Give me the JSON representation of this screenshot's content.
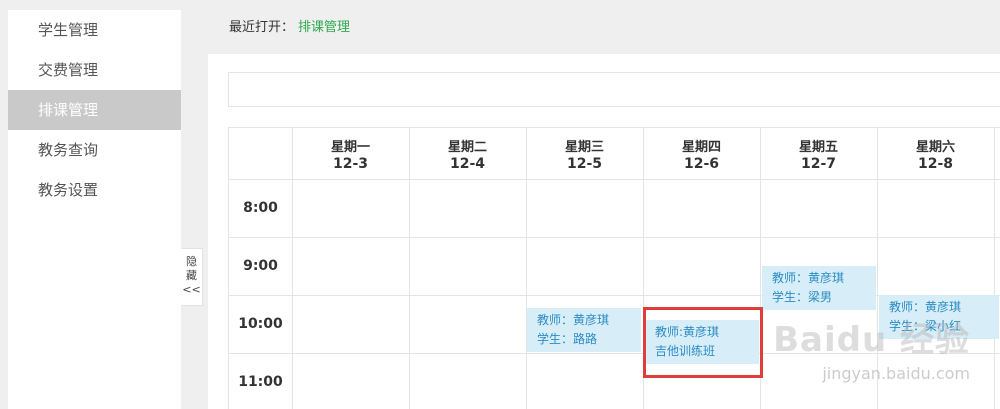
{
  "sidebar": {
    "items": [
      {
        "label": "学生管理"
      },
      {
        "label": "交费管理"
      },
      {
        "label": "排课管理"
      },
      {
        "label": "教务查询"
      },
      {
        "label": "教务设置"
      }
    ]
  },
  "collapse_tab": {
    "line1": "隐",
    "line2": "藏",
    "arrows": "<<"
  },
  "recent": {
    "label": "最近打开：",
    "link": "排课管理"
  },
  "schedule": {
    "days": [
      {
        "weekday": "星期一",
        "date": "12-3"
      },
      {
        "weekday": "星期二",
        "date": "12-4"
      },
      {
        "weekday": "星期三",
        "date": "12-5"
      },
      {
        "weekday": "星期四",
        "date": "12-6"
      },
      {
        "weekday": "星期五",
        "date": "12-7"
      },
      {
        "weekday": "星期六",
        "date": "12-8"
      }
    ],
    "times": [
      "8:00",
      "9:00",
      "10:00",
      "11:00"
    ],
    "events": [
      {
        "line1": "教师：黄彦琪",
        "line2": "学生：路路"
      },
      {
        "line1": "教师:黄彦琪",
        "line2": "吉他训练班"
      },
      {
        "line1": "教师：黄彦琪",
        "line2": "学生：梁男"
      },
      {
        "line1": "教师：黄彦琪",
        "line2": "学生：梁小红"
      }
    ]
  },
  "watermark": {
    "brand": "Baidu 经验",
    "url": "jingyan.baidu.com"
  }
}
